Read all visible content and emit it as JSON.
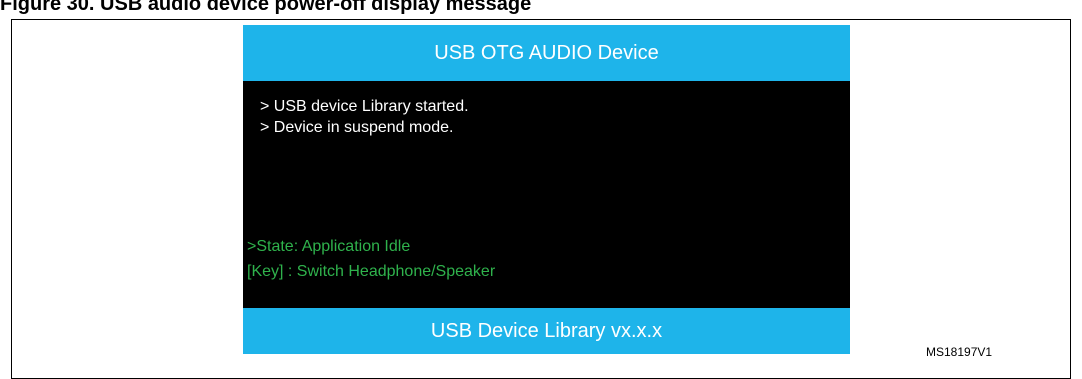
{
  "caption": "Figure 30.  USB audio device power-off display message",
  "screen": {
    "header_title": "USB OTG AUDIO Device",
    "log_lines": [
      "> USB device Library started.",
      "> Device in suspend mode."
    ],
    "status_lines": [
      ">State: Application Idle",
      "[Key] : Switch Headphone/Speaker"
    ],
    "footer_title": "USB Device Library vx.x.x"
  },
  "reference_code": "MS18197V1",
  "colors": {
    "bar_blue": "#1eb4ea",
    "screen_black": "#000000",
    "status_green": "#2fb24c",
    "log_white": "#ffffff"
  }
}
